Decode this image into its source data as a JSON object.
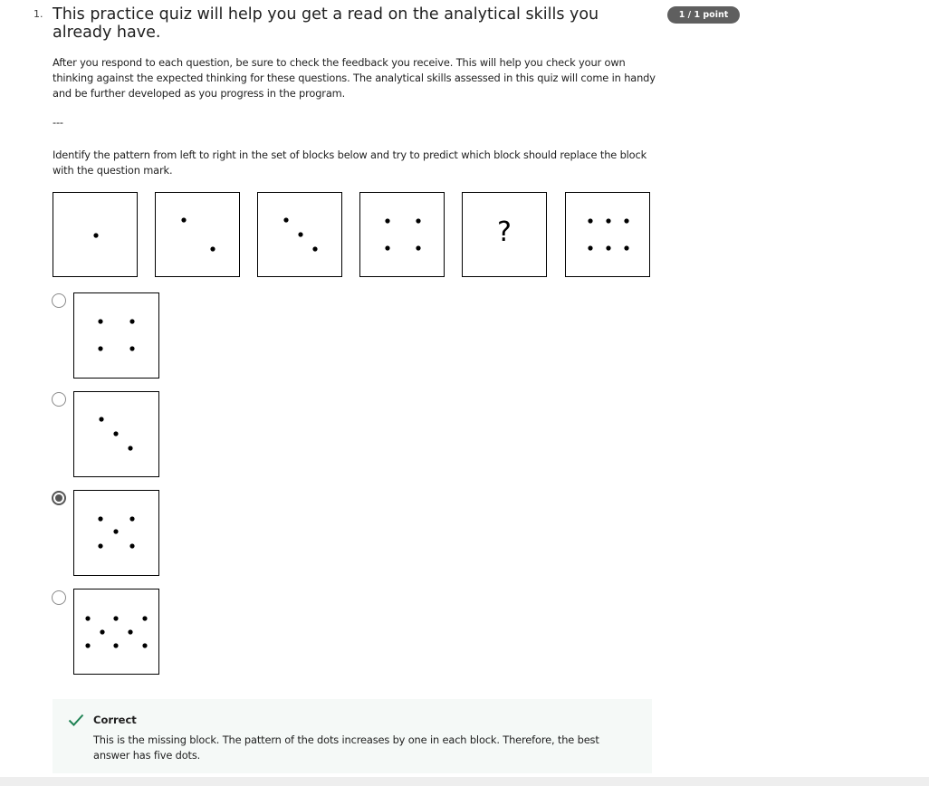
{
  "question": {
    "number": "1.",
    "title": "This practice quiz will help you get a read on the analytical skills you already have.",
    "score_badge": "1 / 1 point",
    "intro": "After you respond to each question, be sure to check the feedback you receive. This will help you  check your own thinking against the expected thinking for these questions. The analytical skills assessed in this quiz will come in handy and be further developed as you progress in the program.",
    "separator": "---",
    "prompt": "Identify the pattern from left to right in the set of blocks below and try to predict which block should replace the block with the question mark."
  },
  "sequence": {
    "blocks": [
      {
        "dots": 1
      },
      {
        "dots": 2
      },
      {
        "dots": 3
      },
      {
        "dots": 4
      },
      {
        "question_mark": "?"
      },
      {
        "dots": 6
      }
    ]
  },
  "options": [
    {
      "dots": 4,
      "selected": false
    },
    {
      "dots": 3,
      "selected": false
    },
    {
      "dots": 5,
      "selected": true
    },
    {
      "dots": 8,
      "selected": false
    }
  ],
  "feedback": {
    "status": "Correct",
    "text": "This is the missing block. The pattern of the dots increases by one in each block. Therefore, the best answer has five dots.",
    "color": "#1f8354"
  }
}
